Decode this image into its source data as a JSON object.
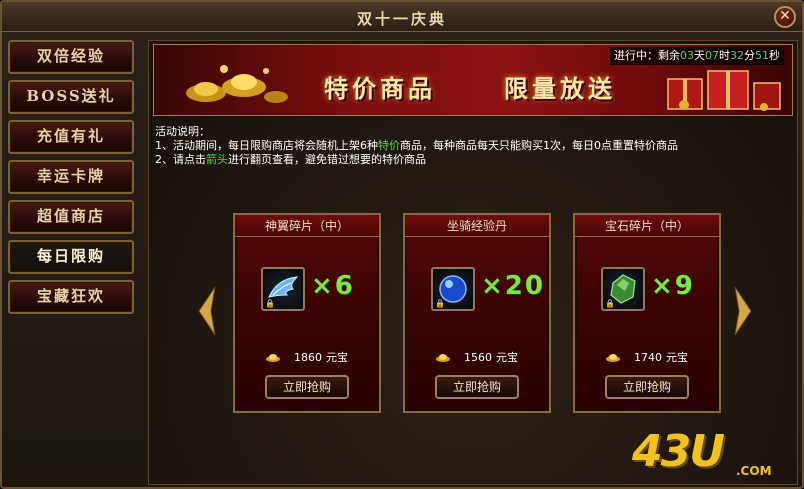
{
  "window": {
    "title": "双十一庆典",
    "close_label": "✕"
  },
  "sidebar": {
    "items": [
      {
        "label": "双倍经验",
        "active": false
      },
      {
        "label": "BOSS送礼",
        "active": false
      },
      {
        "label": "充值有礼",
        "active": false
      },
      {
        "label": "幸运卡牌",
        "active": false
      },
      {
        "label": "超值商店",
        "active": false
      },
      {
        "label": "每日限购",
        "active": true
      },
      {
        "label": "宝藏狂欢",
        "active": false
      }
    ]
  },
  "banner": {
    "title": "特价商品",
    "subtitle": "限量放送",
    "countdown": {
      "prefix": "进行中：剩余",
      "days": "03",
      "days_unit": "天",
      "hours": "07",
      "hours_unit": "时",
      "minutes": "32",
      "minutes_unit": "分",
      "seconds": "51",
      "seconds_unit": "秒"
    }
  },
  "description": {
    "heading": "活动说明：",
    "line1_a": "1、活动期间，每日限购商店将会随机上架",
    "line1_b": "6",
    "line1_c": "种",
    "line1_hl": "特价",
    "line1_d": "商品，每种商品每天只能购买1次，每日0点重置特价商品",
    "line2_a": "2、请点击",
    "line2_hl": "箭头",
    "line2_b": "进行翻页查看，避免错过想要的特价商品"
  },
  "items": [
    {
      "name": "神翼碎片（中）",
      "qty": "×6",
      "price": "1860",
      "currency": "元宝",
      "buy_label": "立即抢购",
      "icon": "wing-fragment-icon"
    },
    {
      "name": "坐骑经验丹",
      "qty": "×20",
      "price": "1560",
      "currency": "元宝",
      "buy_label": "立即抢购",
      "icon": "mount-exp-pill-icon"
    },
    {
      "name": "宝石碎片（中）",
      "qty": "×9",
      "price": "1740",
      "currency": "元宝",
      "buy_label": "立即抢购",
      "icon": "gem-fragment-icon"
    }
  ],
  "lock_glyph": "🔒",
  "watermark": {
    "text": "43U",
    "sub": ".COM"
  },
  "colors": {
    "accent_green": "#58d84a",
    "qty_green": "#7ce64a",
    "gold": "#f2c320",
    "panel_red": "#5a0808",
    "frame": "#8a6a3a"
  }
}
